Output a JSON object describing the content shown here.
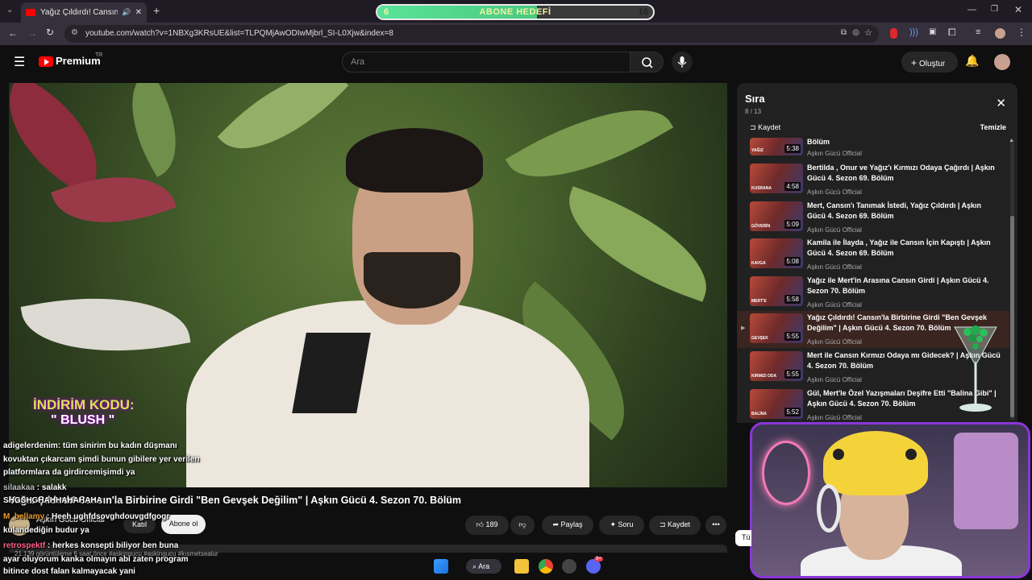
{
  "browser": {
    "tab_title": "Yağız Çıldırdı! Cansın'la Birb",
    "url": "youtube.com/watch?v=1NBXg3KRsUE&list=TLPQMjAwODIwMjbrl_SI-L0Xjw&index=8",
    "goal_label": "ABONE HEDEFİ",
    "goal_start": "6",
    "goal_end": "10",
    "goal_progress": 0.58
  },
  "youtube": {
    "logo_text": "Premium",
    "logo_region": "TR",
    "search_placeholder": "Ara",
    "create_label": "Oluştur"
  },
  "video": {
    "overlay_promo_1": "İNDİRİM KODU:",
    "overlay_promo_2": "\" BLUSH \"",
    "title": "Yağız Çıldırdı! Cansın'la Birbirine Girdi \"Ben Gevşek Değilim\" | Aşkın Gücü 4. Sezon 70. Bölüm",
    "channel": "Aşkın Gücü Official",
    "join_label": "Katıl",
    "subscribe_label": "Abone ol",
    "likes": "189",
    "share_label": "Paylaş",
    "ask_label": "Soru",
    "save_label": "Kaydet",
    "description_meta": "21.139 görüntüleme  6 saat önce  #askıngucu #askingucu #kısmetsealur"
  },
  "playlist": {
    "title": "Sıra",
    "position": "8 / 13",
    "save_label": "Kaydet",
    "clear_label": "Temizle",
    "partial_item": {
      "title_tail": "Bölüm",
      "duration": "5:38",
      "channel": "Aşkın Gücü Official",
      "caption": "YAĞIZ"
    },
    "items": [
      {
        "title": "Bertilda , Onur ve Yağız'ı Kırmızı Odaya Çağırdı | Aşkın Gücü 4. Sezon 69. Bölüm",
        "duration": "4:58",
        "channel": "Aşkın Gücü Official",
        "caption": "KUSRANA"
      },
      {
        "title": "Mert, Cansın'ı Tanımak İstedi, Yağız Çıldırdı | Aşkın Gücü 4. Sezon 69. Bölüm",
        "duration": "5:09",
        "channel": "Aşkın Gücü Official",
        "caption": "GÖVERİN"
      },
      {
        "title": "Kamila ile İlayda , Yağız ile Cansın İçin Kapıştı | Aşkın Gücü 4. Sezon 69. Bölüm",
        "duration": "5:08",
        "channel": "Aşkın Gücü Official",
        "caption": "KAVGA"
      },
      {
        "title": "Yağız ile Mert'in Arasına Cansın Girdi | Aşkın Gücü 4. Sezon 70. Bölüm",
        "duration": "5:58",
        "channel": "Aşkın Gücü Official",
        "caption": "MERT'E"
      },
      {
        "title": "Yağız Çıldırdı! Cansın'la Birbirine Girdi \"Ben Gevşek Değilim\" | Aşkın Gücü 4. Sezon 70. Bölüm",
        "duration": "5:55",
        "channel": "Aşkın Gücü Official",
        "caption": "GEVŞEK"
      },
      {
        "title": "Mert ile Cansın Kırmızı Odaya mı Gidecek? | Aşkın Gücü 4. Sezon 70. Bölüm",
        "duration": "5:55",
        "channel": "Aşkın Gücü Official",
        "caption": "KIRMIZI ODA"
      },
      {
        "title": "Gül, Mert'le Özel Yazışmaları Deşifre Etti \"Balina Gibi\" | Aşkın Gücü 4. Sezon 70. Bölüm",
        "duration": "5:52",
        "channel": "Aşkın Gücü Official",
        "caption": "BALİNA"
      }
    ]
  },
  "chat": [
    {
      "name": "",
      "text": "adigelerdenim: tüm sinirim bu kadın düşmanı"
    },
    {
      "name": "",
      "text": "kovuktan çıkarcam şimdi bunun gibilere yer verilen"
    },
    {
      "name": "",
      "text": "platformlara da girdircemişimdi ya"
    },
    {
      "name": "silaakaa",
      "text": ": salakk"
    },
    {
      "name": "SHGSHGHAHHAHAHAHA",
      "text": ""
    },
    {
      "name": "M_bellamy",
      "text": ": Heeh ughfdsovghdouvgdfgogr"
    },
    {
      "name": "",
      "text": "kulandediğin budur ya"
    },
    {
      "name": "retrospektf",
      "text": ": herkes konsepti biliyor ben buna"
    },
    {
      "name": "",
      "text": "ayar oluyorum kanka olmayın abi zaten program"
    },
    {
      "name": "",
      "text": "bitince dost falan kalmayacak yani"
    }
  ],
  "taskbar": {
    "search_label": "Ara",
    "discord_badge": "9+"
  },
  "colors": {
    "youtube_red": "#ff0000",
    "stream_border": "#8a36d8",
    "active_item_bg": "#3a2520",
    "goal_fill": "#5be39a"
  }
}
